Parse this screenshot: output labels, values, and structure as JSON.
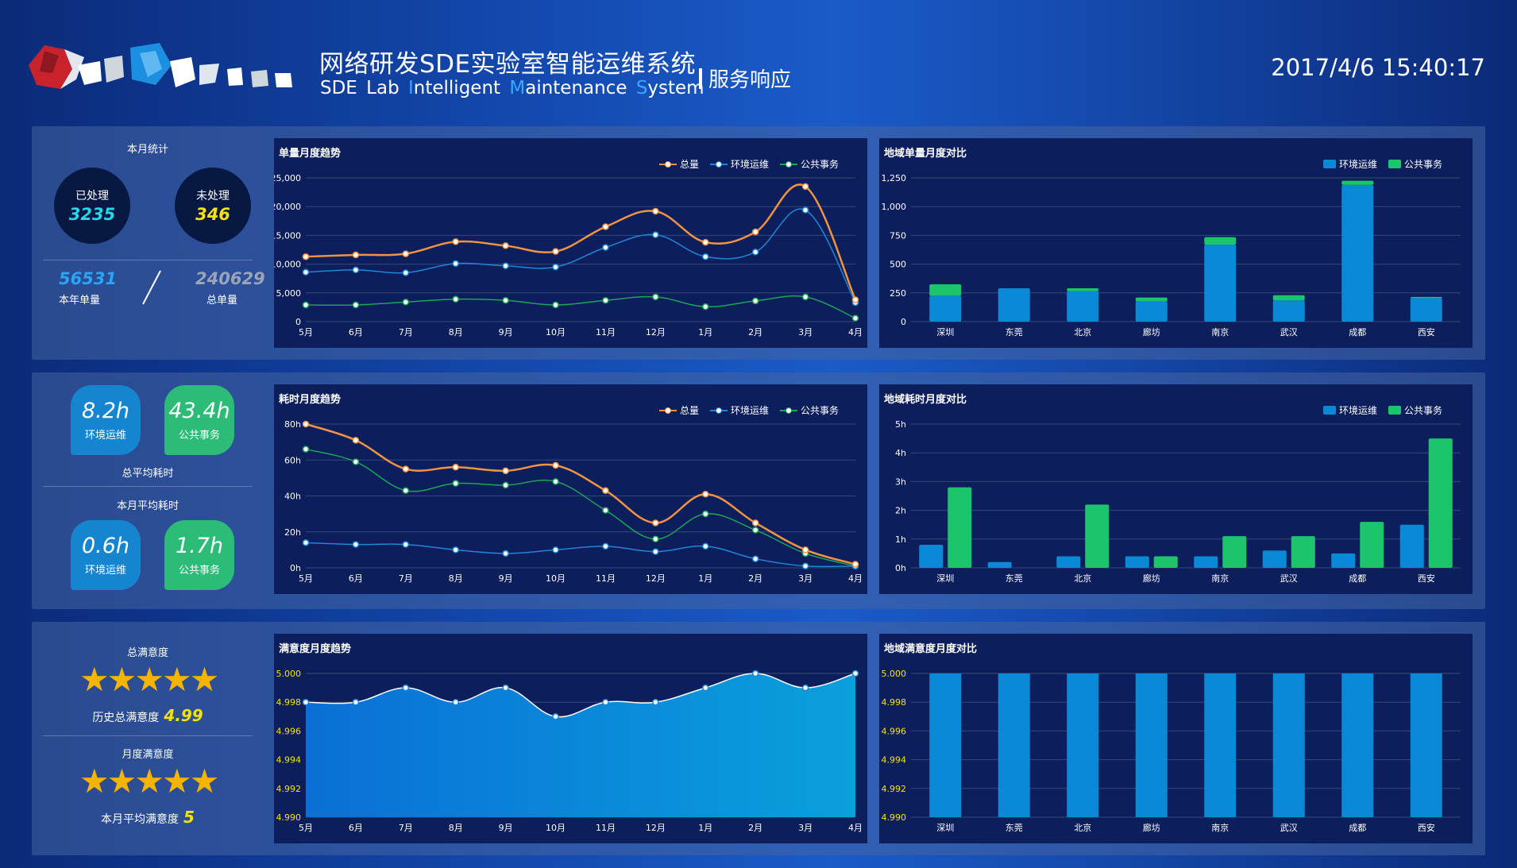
{
  "header": {
    "title_zh": "网络研发SDE实验室智能运维系统",
    "title_en_parts": [
      {
        "text": "SDE ",
        "cap": false
      },
      {
        "text": "Lab ",
        "cap": false
      },
      {
        "text": "I",
        "cap": true
      },
      {
        "text": "ntelligent ",
        "cap": false
      },
      {
        "text": "M",
        "cap": true
      },
      {
        "text": "aintenance ",
        "cap": false
      },
      {
        "text": "S",
        "cap": true
      },
      {
        "text": "ystem",
        "cap": false
      }
    ],
    "subtitle": "服务响应",
    "datetime": "2017/4/6 15:40:17",
    "logo_icon": "mosaic-logo-icon"
  },
  "colors": {
    "orange": "#f29342",
    "blue_line": "#1f86d8",
    "green_line": "#1ea35a",
    "bar_blue": "#0a8ad6",
    "bar_green": "#1cc46c",
    "yellow": "#f6e300",
    "cyan": "#27d6e8"
  },
  "stats": {
    "month_title": "本月统计",
    "processed_label": "已处理",
    "processed_value": "3235",
    "unprocessed_label": "未处理",
    "unprocessed_value": "346",
    "year_value": "56531",
    "year_label": "本年单量",
    "total_value": "240629",
    "total_label": "总单量"
  },
  "duration": {
    "total_env_value": "8.2h",
    "total_env_label": "环境运维",
    "total_pub_value": "43.4h",
    "total_pub_label": "公共事务",
    "total_title": "总平均耗时",
    "month_title": "本月平均耗时",
    "month_env_value": "0.6h",
    "month_env_label": "环境运维",
    "month_pub_value": "1.7h",
    "month_pub_label": "公共事务"
  },
  "satisfaction": {
    "total_title": "总满意度",
    "total_stars": 5,
    "history_label": "历史总满意度",
    "history_value": "4.99",
    "month_title": "月度满意度",
    "month_stars": 5,
    "month_label": "本月平均满意度",
    "month_value": "5"
  },
  "chart_data": [
    {
      "id": "volume-trend",
      "type": "line",
      "title": "单量月度趋势",
      "categories": [
        "5月",
        "6月",
        "7月",
        "8月",
        "9月",
        "10月",
        "11月",
        "12月",
        "1月",
        "2月",
        "3月",
        "4月"
      ],
      "series": [
        {
          "name": "总量",
          "color": "#f29342",
          "values": [
            11300,
            11600,
            11800,
            13900,
            13200,
            12200,
            16500,
            19200,
            13800,
            15600,
            23500,
            3800
          ]
        },
        {
          "name": "环境运维",
          "color": "#1f86d8",
          "values": [
            8600,
            9000,
            8500,
            10100,
            9700,
            9500,
            12900,
            15100,
            11300,
            12100,
            19400,
            3300
          ]
        },
        {
          "name": "公共事务",
          "color": "#1ea35a",
          "values": [
            2900,
            2900,
            3400,
            3900,
            3700,
            2900,
            3700,
            4300,
            2600,
            3600,
            4300,
            600
          ]
        }
      ],
      "yticks": [
        "0",
        "5,000",
        "10,000",
        "15,000",
        "20,000",
        "25,000"
      ],
      "ylim": [
        0,
        25000
      ],
      "legend": "top-right"
    },
    {
      "id": "region-volume",
      "type": "bar",
      "title": "地域单量月度对比",
      "stacked": true,
      "categories": [
        "深圳",
        "东莞",
        "北京",
        "廊坊",
        "南京",
        "武汉",
        "成都",
        "西安"
      ],
      "series": [
        {
          "name": "环境运维",
          "color": "#0a8ad6",
          "values": [
            225,
            290,
            265,
            175,
            670,
            185,
            1190,
            205
          ]
        },
        {
          "name": "公共事务",
          "color": "#1cc46c",
          "values": [
            100,
            0,
            25,
            35,
            65,
            45,
            35,
            10
          ]
        }
      ],
      "yticks": [
        "0",
        "250",
        "500",
        "750",
        "1,000",
        "1,250"
      ],
      "ylim": [
        0,
        1250
      ],
      "legend": "top-right"
    },
    {
      "id": "duration-trend",
      "type": "line",
      "title": "耗时月度趋势",
      "categories": [
        "5月",
        "6月",
        "7月",
        "8月",
        "9月",
        "10月",
        "11月",
        "12月",
        "1月",
        "2月",
        "3月",
        "4月"
      ],
      "series": [
        {
          "name": "总量",
          "color": "#f29342",
          "values": [
            80,
            71,
            55,
            56,
            54,
            57,
            43,
            25,
            41,
            25,
            10,
            2
          ]
        },
        {
          "name": "环境运维",
          "color": "#1f86d8",
          "values": [
            14,
            13,
            13,
            10,
            8,
            10,
            12,
            9,
            12,
            5,
            1,
            1
          ]
        },
        {
          "name": "公共事务",
          "color": "#1ea35a",
          "values": [
            66,
            59,
            43,
            47,
            46,
            48,
            32,
            16,
            30,
            21,
            8,
            1
          ]
        }
      ],
      "yticks": [
        "0h",
        "20h",
        "40h",
        "60h",
        "80h"
      ],
      "ylim": [
        0,
        80
      ],
      "legend": "top-right"
    },
    {
      "id": "region-duration",
      "type": "bar",
      "title": "地域耗时月度对比",
      "stacked": false,
      "categories": [
        "深圳",
        "东莞",
        "北京",
        "廊坊",
        "南京",
        "武汉",
        "成都",
        "西安"
      ],
      "series": [
        {
          "name": "环境运维",
          "color": "#0a8ad6",
          "values": [
            0.8,
            0.2,
            0.4,
            0.4,
            0.4,
            0.6,
            0.5,
            1.5
          ]
        },
        {
          "name": "公共事务",
          "color": "#1cc46c",
          "values": [
            2.8,
            0,
            2.2,
            0.4,
            1.1,
            1.1,
            1.6,
            4.5
          ]
        }
      ],
      "yticks": [
        "0h",
        "1h",
        "2h",
        "3h",
        "4h",
        "5h"
      ],
      "ylim": [
        0,
        5
      ],
      "legend": "top-right"
    },
    {
      "id": "satisfaction-trend",
      "type": "area",
      "title": "满意度月度趋势",
      "categories": [
        "5月",
        "6月",
        "7月",
        "8月",
        "9月",
        "10月",
        "11月",
        "12月",
        "1月",
        "2月",
        "3月",
        "4月"
      ],
      "series": [
        {
          "values": [
            4.998,
            4.998,
            4.999,
            4.998,
            4.999,
            4.997,
            4.998,
            4.998,
            4.999,
            5.0,
            4.999,
            5.0
          ]
        }
      ],
      "yticks": [
        "4.990",
        "4.992",
        "4.994",
        "4.996",
        "4.998",
        "5.000"
      ],
      "ylim": [
        4.99,
        5.0
      ]
    },
    {
      "id": "region-satisfaction",
      "type": "bar",
      "title": "地域满意度月度对比",
      "categories": [
        "深圳",
        "东莞",
        "北京",
        "廊坊",
        "南京",
        "武汉",
        "成都",
        "西安"
      ],
      "series": [
        {
          "values": [
            5.0,
            5.0,
            5.0,
            5.0,
            5.0,
            5.0,
            5.0,
            5.0
          ]
        }
      ],
      "yticks": [
        "4.990",
        "4.992",
        "4.994",
        "4.996",
        "4.998",
        "5.000"
      ],
      "ylim": [
        4.99,
        5.0
      ]
    }
  ]
}
